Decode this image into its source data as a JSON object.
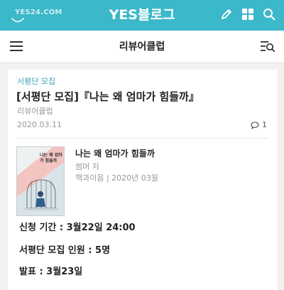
{
  "header": {
    "logo_text": "YES24.COM",
    "title": "YES블로그",
    "icons": [
      "pencil-icon",
      "grid-icon",
      "search-icon"
    ],
    "bg_color": "#3bb8c9"
  },
  "subheader": {
    "title": "리뷰어클럽",
    "icons": [
      "hamburger-menu-icon",
      "list-search-icon"
    ]
  },
  "post": {
    "category": "서평단 모집",
    "title": "[서평단 모집]『나는 왜 엄마가 힘들까』",
    "author": "리뷰어클럽",
    "date": "2020.03.11",
    "comment_count": "1",
    "accent_color": "#3aa4b6"
  },
  "book": {
    "cover_text": "나는 왜 엄마가 힘들까",
    "title": "나는 왜 엄마가 힘들까",
    "author": "썸머 저",
    "publisher_date": "책과이음 | 2020년 03월"
  },
  "details": {
    "period": "신청 기간 : 3월22일 24:00",
    "recruit": "서평단 모집 인원 : 5명",
    "announce": "발표 : 3월23일"
  }
}
